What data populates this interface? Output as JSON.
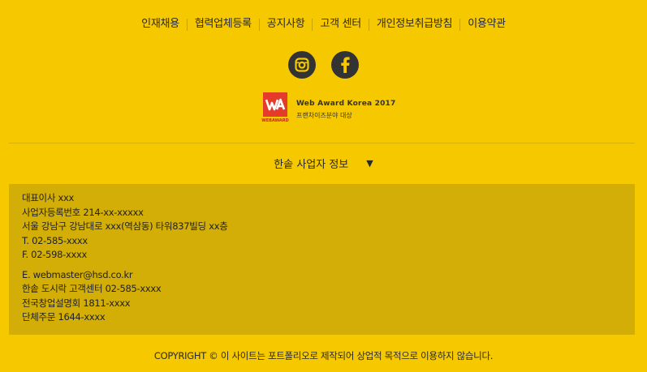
{
  "nav": {
    "items": [
      {
        "label": "인재채용"
      },
      {
        "label": "협력업체등록"
      },
      {
        "label": "공지사항"
      },
      {
        "label": "고객 센터"
      },
      {
        "label": "개인정보취급방침"
      },
      {
        "label": "이용약관"
      }
    ]
  },
  "sns": {
    "instagram_icon": "instagram-icon",
    "facebook_icon": "facebook-icon"
  },
  "award": {
    "logo_text": "WEBAWARD",
    "title": "Web Award Korea 2017",
    "subtitle": "프랜차이즈분야 대상"
  },
  "business_info": {
    "toggle_label": "한솥 사업자 정보",
    "toggle_icon": "triangle-down-icon",
    "lines_group1": [
      "대표이사 xxx",
      "사업자등록번호 214-xx-xxxxx",
      "서울 강남구 강남대로 xxx(역삼동) 타워837빌딩 xx층",
      "T. 02-585-xxxx",
      "F. 02-598-xxxx"
    ],
    "lines_group2": [
      "E. webmaster@hsd.co.kr",
      "한솥 도시락 고객센터 02-585-xxxx",
      "전국창업설명회 1811-xxxx",
      "단체주문 1644-xxxx"
    ]
  },
  "copyright": "COPYRIGHT © 이 사이트는 포트폴리오로 제작되어 상업적 목적으로 이용하지 않습니다.",
  "colors": {
    "background": "#f5c800",
    "info_box": "#d2ae06",
    "icon_circle": "#333333",
    "award_red": "#e43b2a"
  }
}
